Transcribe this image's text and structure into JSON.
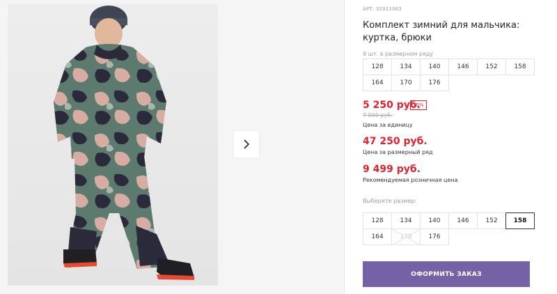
{
  "product": {
    "article": "АРТ. 32311063",
    "title": "Комплект зимний для мальчика: куртка, брюки",
    "pack_info": "9 шт. в размерном ряду",
    "pack_sizes": [
      "128",
      "134",
      "140",
      "146",
      "152",
      "158",
      "164",
      "170",
      "176"
    ]
  },
  "pricing": {
    "unit_price": "5 250 руб.",
    "discount": "25%",
    "old_price": "7 000 руб.",
    "unit_price_label": "Цена за единицу",
    "row_price": "47 250 руб.",
    "row_price_label": "Цена за размерный ряд",
    "retail_price": "9 499 руб.",
    "retail_price_label": "Рекомендуемая розничная цена"
  },
  "size_select": {
    "label": "Выберите размер:",
    "options": [
      "128",
      "134",
      "140",
      "146",
      "152",
      "158",
      "164",
      "170",
      "176"
    ],
    "selected": "158",
    "unavailable": [
      "170"
    ]
  },
  "actions": {
    "order_label": "ОФОРМИТЬ ЗАКАЗ"
  },
  "icons": {
    "gallery_next": "chevron-right-icon"
  },
  "colors": {
    "accent_price": "#e3222f",
    "order_button": "#7562a6"
  }
}
